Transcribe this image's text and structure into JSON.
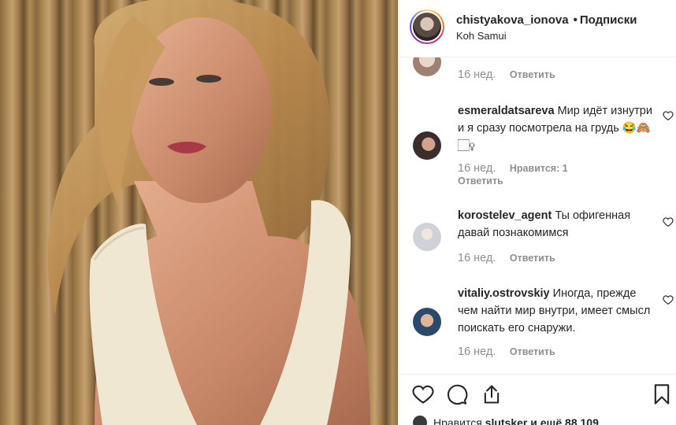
{
  "post": {
    "username": "chistyakova_ionova",
    "separator": "•",
    "follow_label": "Подписки",
    "location": "Koh Samui"
  },
  "comments": [
    {
      "time": "16 нед.",
      "reply_label": "Ответить"
    },
    {
      "username": "esmeraldatsareva",
      "text": "Мир идёт изнутри и я сразу посмотрела на грудь 😂🙈🏻‍♀",
      "time": "16 нед.",
      "likes_label": "Нравится: 1",
      "reply_label": "Ответить"
    },
    {
      "username": "korostelev_agent",
      "text": "Ты офигенная давай познакомимся",
      "time": "16 нед.",
      "reply_label": "Ответить"
    },
    {
      "username": "vitaliy.ostrovskiy",
      "text": "Иногда, прежде чем найти мир внутри, имеет смысл поискать его снаружи.",
      "time": "16 нед.",
      "reply_label": "Ответить"
    }
  ],
  "actions": {
    "like_icon": "heart-icon",
    "comment_icon": "comment-icon",
    "share_icon": "share-icon",
    "save_icon": "bookmark-icon"
  },
  "likes": {
    "prefix": "Нравится",
    "user": "slutsker",
    "suffix": "и ещё 88 109"
  },
  "colors": {
    "border": "#efefef",
    "muted": "#8e8e8e",
    "text": "#262626"
  }
}
